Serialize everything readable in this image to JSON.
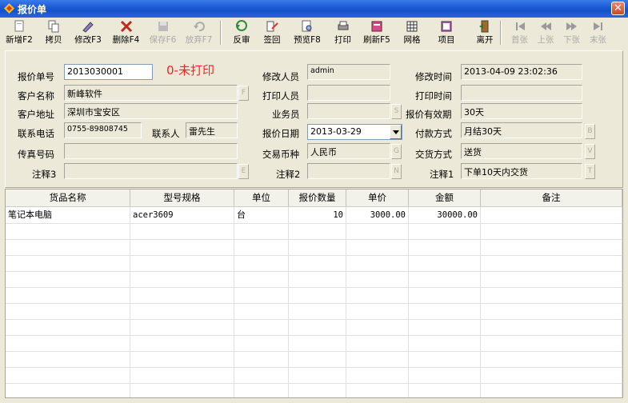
{
  "window": {
    "title": "报价单"
  },
  "toolbar": [
    {
      "label": "新增F2",
      "icon": "new-doc-icon",
      "enabled": true
    },
    {
      "label": "拷贝",
      "icon": "copy-icon",
      "enabled": true
    },
    {
      "label": "修改F3",
      "icon": "edit-icon",
      "enabled": true
    },
    {
      "label": "删除F4",
      "icon": "delete-icon",
      "enabled": true
    },
    {
      "label": "保存F6",
      "icon": "save-icon",
      "enabled": false
    },
    {
      "label": "放弃F7",
      "icon": "undo-icon",
      "enabled": false
    },
    {
      "label": "反审",
      "icon": "unaudit-icon",
      "enabled": true
    },
    {
      "label": "签回",
      "icon": "signback-icon",
      "enabled": true
    },
    {
      "label": "预览F8",
      "icon": "preview-icon",
      "enabled": true
    },
    {
      "label": "打印",
      "icon": "print-icon",
      "enabled": true
    },
    {
      "label": "刷新F5",
      "icon": "refresh-icon",
      "enabled": true
    },
    {
      "label": "网格",
      "icon": "grid-icon",
      "enabled": true
    },
    {
      "label": "项目",
      "icon": "project-icon",
      "enabled": true
    },
    {
      "label": "离开",
      "icon": "exit-icon",
      "enabled": true
    },
    {
      "label": "首张",
      "icon": "first-record-icon",
      "enabled": false
    },
    {
      "label": "上张",
      "icon": "prev-record-icon",
      "enabled": false
    },
    {
      "label": "下张",
      "icon": "next-record-icon",
      "enabled": false
    },
    {
      "label": "末张",
      "icon": "last-record-icon",
      "enabled": false
    }
  ],
  "form": {
    "quote_no": {
      "label": "报价单号",
      "value": "2013030001"
    },
    "status": "0-未打印",
    "customer_name": {
      "label": "客户名称",
      "value": "新峰软件",
      "btn": "F"
    },
    "customer_addr": {
      "label": "客户地址",
      "value": "深圳市宝安区"
    },
    "phone": {
      "label": "联系电话",
      "value": "0755-89808745"
    },
    "contact": {
      "label": "联系人",
      "value": "雷先生"
    },
    "fax": {
      "label": "传真号码",
      "value": ""
    },
    "note3": {
      "label": "注释3",
      "value": "",
      "btn": "E"
    },
    "modifier": {
      "label": "修改人员",
      "value": "admin"
    },
    "printer": {
      "label": "打印人员",
      "value": ""
    },
    "salesman": {
      "label": "业务员",
      "value": "",
      "btn": "S"
    },
    "quote_date": {
      "label": "报价日期",
      "value": "2013-03-29"
    },
    "currency": {
      "label": "交易币种",
      "value": "人民币",
      "btn": "G"
    },
    "note2": {
      "label": "注释2",
      "value": "",
      "btn": "N"
    },
    "modify_time": {
      "label": "修改时间",
      "value": "2013-04-09 23:02:36"
    },
    "print_time": {
      "label": "打印时间",
      "value": ""
    },
    "validity": {
      "label": "报价有效期",
      "value": "30天"
    },
    "payment": {
      "label": "付款方式",
      "value": "月结30天",
      "btn": "B"
    },
    "delivery": {
      "label": "交货方式",
      "value": "送货",
      "btn": "V"
    },
    "note1": {
      "label": "注释1",
      "value": "下单10天内交货",
      "btn": "T"
    }
  },
  "grid": {
    "headers": [
      "货品名称",
      "型号规格",
      "单位",
      "报价数量",
      "单价",
      "金额",
      "备注"
    ],
    "rows": [
      [
        "笔记本电脑",
        "acer3609",
        "台",
        "10",
        "3000.00",
        "30000.00",
        ""
      ]
    ]
  }
}
